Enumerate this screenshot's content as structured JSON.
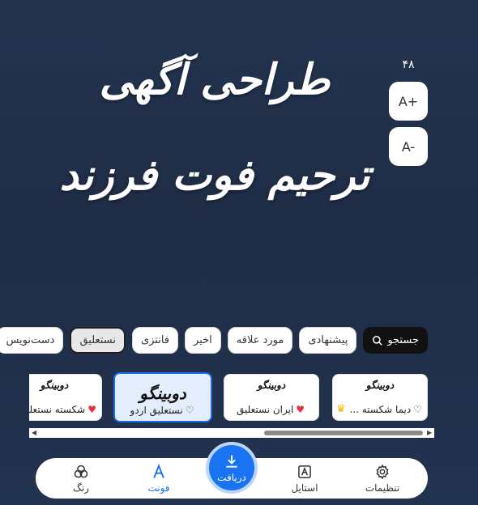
{
  "headline": "طراحی آگهی ترحیم فوت فرزند",
  "font_size": "۴۸",
  "size_controls": {
    "increase": "A+",
    "decrease": "A-"
  },
  "categories": [
    {
      "label": "جستجو",
      "icon": "search-icon"
    },
    {
      "label": "پیشنهادی"
    },
    {
      "label": "مورد علاقه"
    },
    {
      "label": "اخیر"
    },
    {
      "label": "فانتزی"
    },
    {
      "label": "نستعلیق"
    },
    {
      "label": "دست‌نویس"
    }
  ],
  "active_category": "نستعلیق",
  "font_cards": [
    {
      "sample": "دوبینگو",
      "name": "دیما شکسته ...",
      "favorite": false,
      "premium": true
    },
    {
      "sample": "دوبینگو",
      "name": "ایران نستعلیق",
      "favorite": true,
      "premium": false
    },
    {
      "sample": "دوبینگو",
      "name": "نستعلیق اردو",
      "favorite": false,
      "premium": false,
      "selected": true
    },
    {
      "sample": "دوبینگو",
      "name": "شکسته نستعلیق",
      "favorite": true,
      "premium": false
    }
  ],
  "bottom_nav": {
    "settings": "تنظیمات",
    "style": "استایل",
    "download": "دریافت",
    "font": "فونت",
    "color": "رنگ"
  },
  "colors": {
    "accent": "#1a73f0",
    "background": "#223350"
  }
}
